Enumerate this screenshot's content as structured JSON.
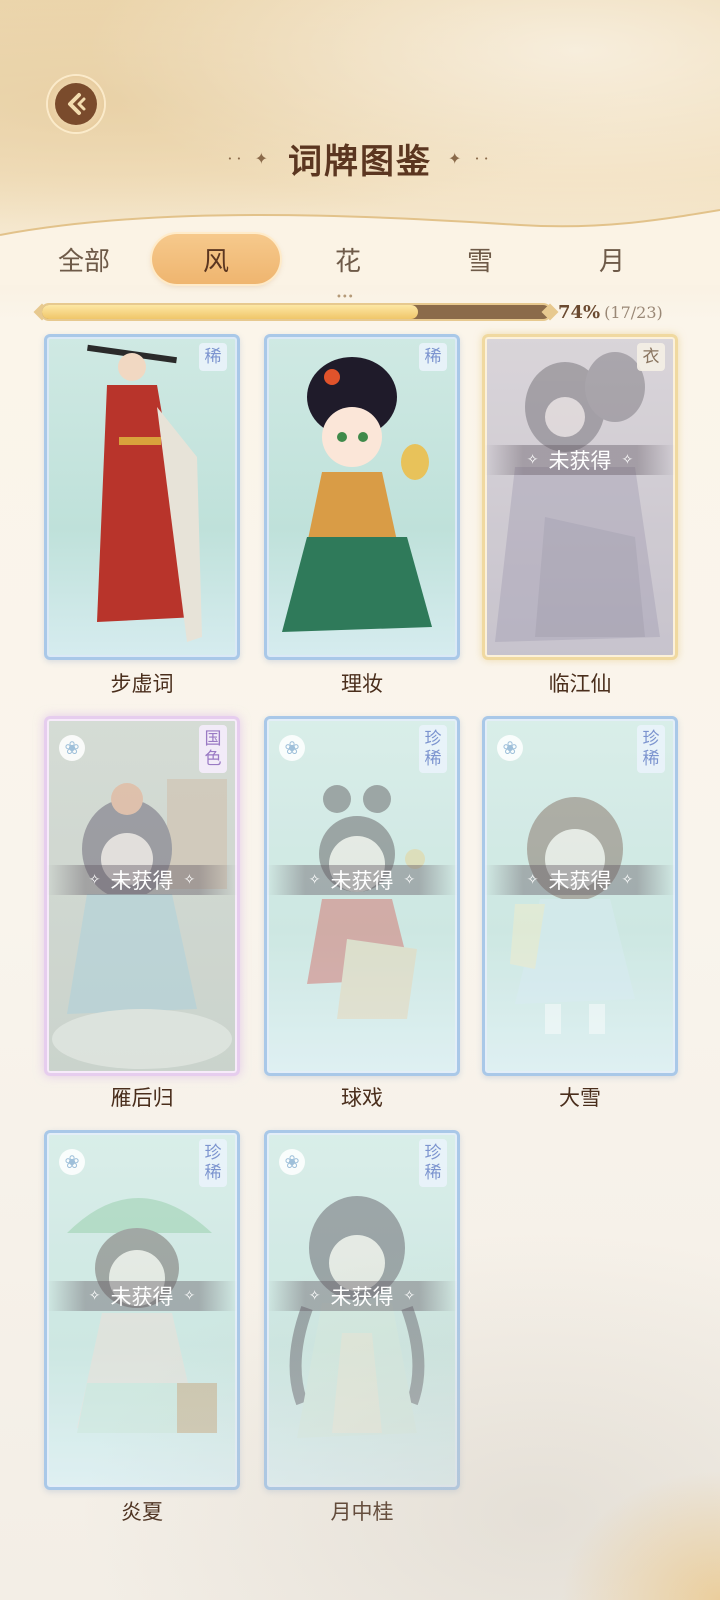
{
  "header": {
    "title": "词牌图鉴",
    "title_deco_left": "·· ✦",
    "title_deco_right": "✦ ··"
  },
  "tabs": [
    {
      "label": "全部",
      "active": false
    },
    {
      "label": "风",
      "active": true
    },
    {
      "label": "花",
      "active": false
    },
    {
      "label": "雪",
      "active": false
    },
    {
      "label": "月",
      "active": false
    }
  ],
  "progress": {
    "percent_label": "74%",
    "count_label": "(17/23)",
    "fraction": 0.74
  },
  "locked_label": "未获得",
  "cards": [
    {
      "name": "步虚词",
      "badge": "稀",
      "locked": false,
      "style": "normal"
    },
    {
      "name": "理妆",
      "badge": "稀",
      "locked": false,
      "style": "normal"
    },
    {
      "name": "临江仙",
      "badge": "衣",
      "locked": true,
      "style": "gold"
    },
    {
      "name": "雁后归",
      "badge": "国色",
      "locked": true,
      "style": "guose"
    },
    {
      "name": "球戏",
      "badge": "珍稀",
      "locked": true,
      "style": "normal"
    },
    {
      "name": "大雪",
      "badge": "珍稀",
      "locked": true,
      "style": "normal"
    },
    {
      "name": "炎夏",
      "badge": "珍稀",
      "locked": true,
      "style": "normal"
    },
    {
      "name": "月中桂",
      "badge": "珍稀",
      "locked": true,
      "style": "normal"
    }
  ],
  "colors": {
    "accent": "#f0b86f",
    "title": "#5b3620",
    "card_border": "#a9c8e8",
    "progress_fill": "#f0c66a",
    "progress_track": "#8b6b4a"
  },
  "icons": {
    "back": "back-arrow-icon",
    "card_flower": "flower-icon",
    "spark": "sparkle-icon"
  }
}
